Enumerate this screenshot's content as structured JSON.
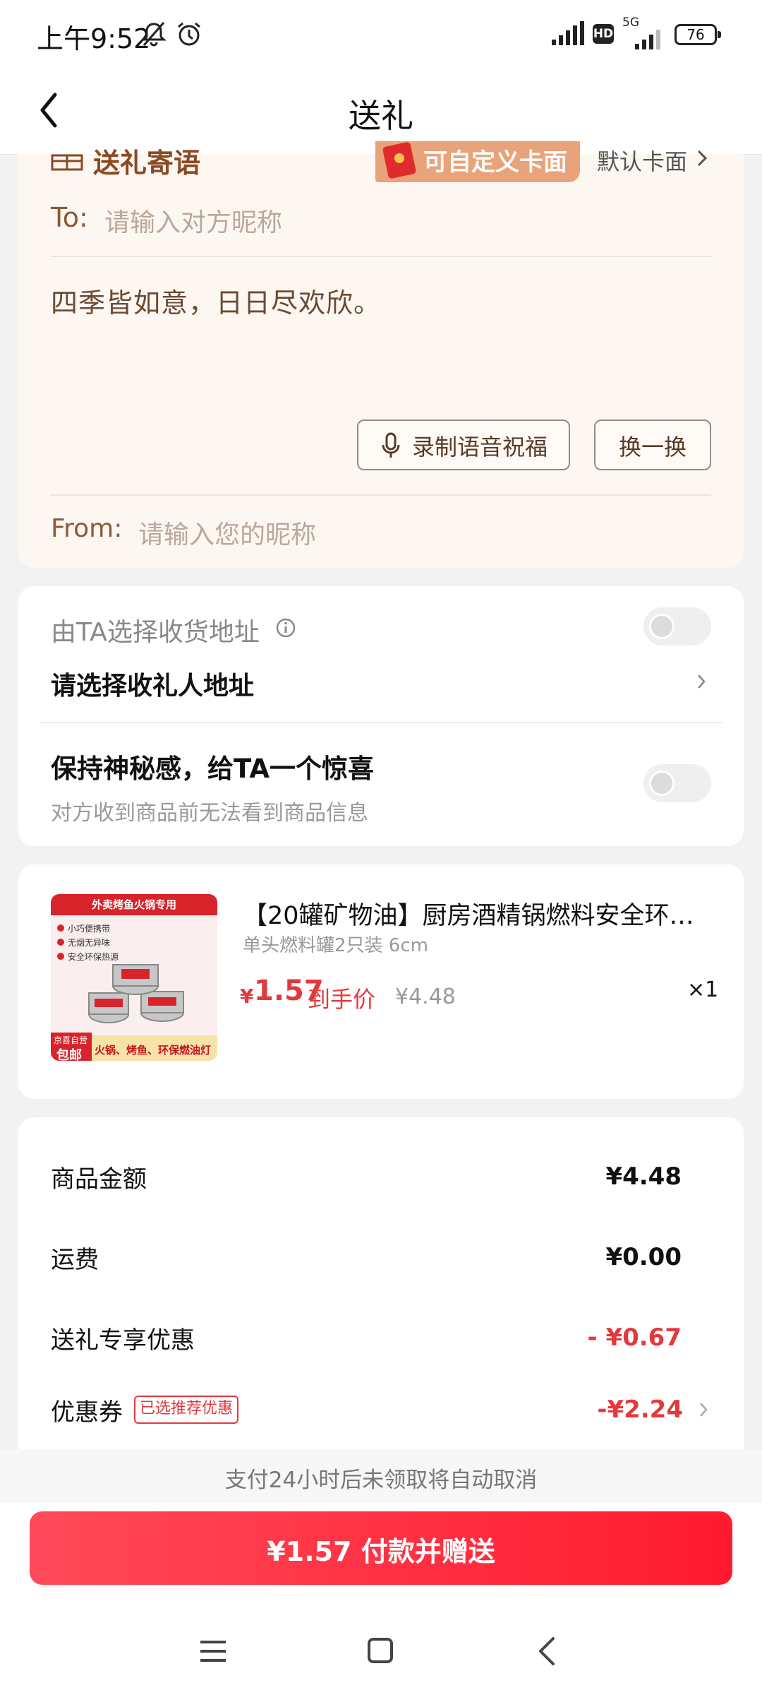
{
  "status_bar": {
    "time": "上午9:52",
    "network": "5G",
    "hd": "HD",
    "battery": "76"
  },
  "header": {
    "title": "送礼"
  },
  "greeting_card": {
    "title": "送礼寄语",
    "custom_tag_label": "可自定义卡面",
    "default_card_link": "默认卡面",
    "to_label": "To:",
    "to_placeholder": "请输入对方昵称",
    "message": "四季皆如意，日日尽欢欣。",
    "voice_button": "录制语音祝福",
    "swap_button": "换一换",
    "from_label": "From:",
    "from_placeholder": "请输入您的昵称"
  },
  "address": {
    "choose_by_recipient": "由TA选择收货地址",
    "select_address": "请选择收礼人地址",
    "surprise_title": "保持神秘感，给TA一个惊喜",
    "surprise_sub": "对方收到商品前无法看到商品信息"
  },
  "product": {
    "title": "【20罐矿物油】厨房酒精锅燃料安全环保…",
    "spec": "单头燃料罐2只装 6cm",
    "price_symbol": "¥",
    "price": "1.57",
    "price_label": "到手价",
    "original_price": "¥4.48",
    "quantity": "×1",
    "image_banner": "外卖烤鱼火锅专用",
    "image_features": [
      "小巧便携带",
      "无烟无异味",
      "安全环保热源"
    ],
    "image_badge_top": "京喜自营",
    "image_badge": "包邮",
    "image_footer": "火锅、烤鱼、环保燃油灯"
  },
  "summary": {
    "rows": [
      {
        "label": "商品金额",
        "value": "¥4.48",
        "color": "#111111"
      },
      {
        "label": "运费",
        "value": "¥0.00",
        "color": "#111111"
      },
      {
        "label": "送礼专享优惠",
        "value": "- ¥0.67",
        "color": "#e4393c"
      },
      {
        "label": "优惠券",
        "value": "-¥2.24",
        "color": "#e4393c"
      }
    ],
    "coupon_tag": "已选推荐优惠"
  },
  "footer": {
    "notice": "支付24小时后未领取将自动取消",
    "pay_button": "¥1.57 付款并赠送"
  },
  "colors": {
    "accent_red": "#e4393c",
    "pay_gradient_start": "#ff4a5a",
    "pay_gradient_end": "#ff1a2e",
    "card_bg": "#fdf7f2"
  }
}
